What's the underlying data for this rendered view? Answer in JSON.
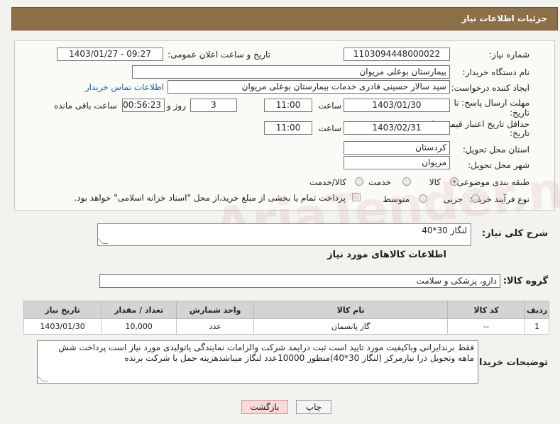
{
  "header": {
    "title": "جزئیات اطلاعات نیاز"
  },
  "labels": {
    "need_number": "شماره نیاز:",
    "announce_datetime": "تاریخ و ساعت اعلان عمومی:",
    "buyer_org": "نام دستگاه خریدار:",
    "requester": "ایجاد کننده درخواست:",
    "contact_link": "اطلاعات تماس خریدار",
    "reply_deadline_1": "مهلت ارسال پاسخ: تا",
    "reply_deadline_2": "تاریخ:",
    "time_word": "ساعت",
    "day_and": "روز و",
    "remaining": "ساعت باقی مانده",
    "price_validity_1": "حداقل تاریخ اعتبار قیمت: تا",
    "price_validity_2": "تاریخ:",
    "province": "استان محل تحویل:",
    "city": "شهر محل تحویل:",
    "category": "طبقه بندی موضوعی:",
    "process": "نوع فرآیند خرید :",
    "overall_desc": "شرح کلی نیاز:",
    "goods_info": "اطلاعات کالاهای مورد نیاز",
    "goods_group": "گروه کالا:",
    "buyer_notes": "توضیحات خریدار:"
  },
  "values": {
    "need_number": "1103094448000022",
    "announce_datetime": "1403/01/27 - 09:27",
    "buyer_org": "بیمارستان بوعلی مریوان",
    "requester": "سید سالار حسینی قادری خدمات بیمارستان بوعلی مریوان",
    "reply_date": "1403/01/30",
    "reply_time": "11:00",
    "days": "3",
    "remaining_time": "00:56:23",
    "validity_date": "1403/02/31",
    "validity_time": "11:00",
    "province": "کردستان",
    "city": "مریوان",
    "overall_desc": "لنگاز 30*40",
    "goods_group": "دارو، پزشکی و سلامت",
    "buyer_notes": "فقط برندایرانی وباکیفیت مورد تایید است ثبت درایمد شرکت والزامات نمایندگی یاتولیدی مورد نیاز است پرداخت شش ماهه وتحویل درا نبارمرکز (لنگاز 30*40)منظور 10000عدد لنگاز میباشدهزینه حمل با شرکت برنده"
  },
  "category_options": {
    "goods": "کالا",
    "service": "خدمت",
    "goods_service": "کالا/خدمت",
    "selected": "کالا"
  },
  "process_options": {
    "partial": "جزیی",
    "medium": "متوسط",
    "treasury_note": "پرداخت تمام یا بخشی از مبلغ خرید،از محل \"اسناد خزانه اسلامی\" خواهد بود.",
    "selected": "جزیی"
  },
  "table": {
    "headers": [
      "ردیف",
      "کد کالا",
      "نام کالا",
      "واحد شمارش",
      "تعداد / مقدار",
      "تاریخ نیاز"
    ],
    "rows": [
      [
        "1",
        "--",
        "گاز پانسمان",
        "عدد",
        "10,000",
        "1403/01/30"
      ]
    ]
  },
  "buttons": {
    "print": "چاپ",
    "back": "بازگشت"
  },
  "watermark": "AriaTender.net",
  "colors": {
    "header_bg": "#8a6f48",
    "link": "#1f5fa8",
    "back_button": "#f7d9d9"
  }
}
